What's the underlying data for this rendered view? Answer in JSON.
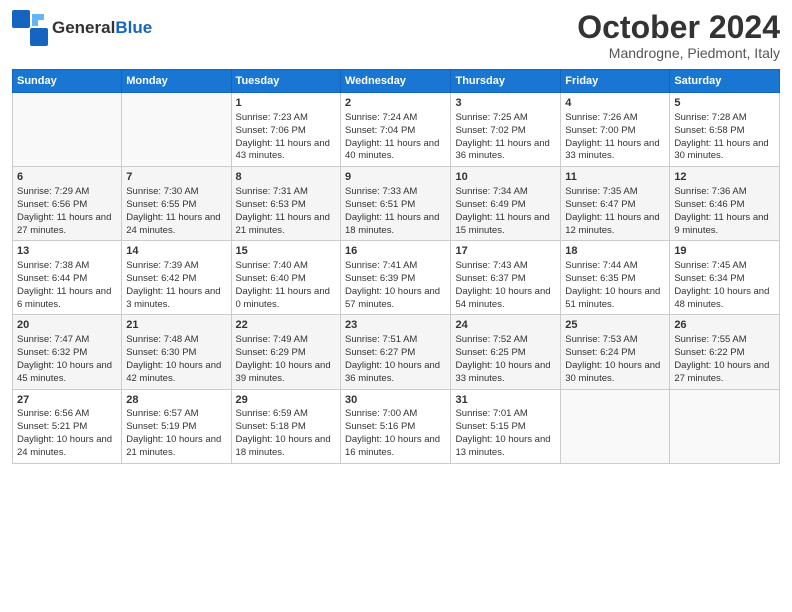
{
  "header": {
    "logo_general": "General",
    "logo_blue": "Blue",
    "month_title": "October 2024",
    "location": "Mandrogne, Piedmont, Italy"
  },
  "days_of_week": [
    "Sunday",
    "Monday",
    "Tuesday",
    "Wednesday",
    "Thursday",
    "Friday",
    "Saturday"
  ],
  "weeks": [
    [
      {
        "day": "",
        "info": ""
      },
      {
        "day": "",
        "info": ""
      },
      {
        "day": "1",
        "info": "Sunrise: 7:23 AM\nSunset: 7:06 PM\nDaylight: 11 hours and 43 minutes."
      },
      {
        "day": "2",
        "info": "Sunrise: 7:24 AM\nSunset: 7:04 PM\nDaylight: 11 hours and 40 minutes."
      },
      {
        "day": "3",
        "info": "Sunrise: 7:25 AM\nSunset: 7:02 PM\nDaylight: 11 hours and 36 minutes."
      },
      {
        "day": "4",
        "info": "Sunrise: 7:26 AM\nSunset: 7:00 PM\nDaylight: 11 hours and 33 minutes."
      },
      {
        "day": "5",
        "info": "Sunrise: 7:28 AM\nSunset: 6:58 PM\nDaylight: 11 hours and 30 minutes."
      }
    ],
    [
      {
        "day": "6",
        "info": "Sunrise: 7:29 AM\nSunset: 6:56 PM\nDaylight: 11 hours and 27 minutes."
      },
      {
        "day": "7",
        "info": "Sunrise: 7:30 AM\nSunset: 6:55 PM\nDaylight: 11 hours and 24 minutes."
      },
      {
        "day": "8",
        "info": "Sunrise: 7:31 AM\nSunset: 6:53 PM\nDaylight: 11 hours and 21 minutes."
      },
      {
        "day": "9",
        "info": "Sunrise: 7:33 AM\nSunset: 6:51 PM\nDaylight: 11 hours and 18 minutes."
      },
      {
        "day": "10",
        "info": "Sunrise: 7:34 AM\nSunset: 6:49 PM\nDaylight: 11 hours and 15 minutes."
      },
      {
        "day": "11",
        "info": "Sunrise: 7:35 AM\nSunset: 6:47 PM\nDaylight: 11 hours and 12 minutes."
      },
      {
        "day": "12",
        "info": "Sunrise: 7:36 AM\nSunset: 6:46 PM\nDaylight: 11 hours and 9 minutes."
      }
    ],
    [
      {
        "day": "13",
        "info": "Sunrise: 7:38 AM\nSunset: 6:44 PM\nDaylight: 11 hours and 6 minutes."
      },
      {
        "day": "14",
        "info": "Sunrise: 7:39 AM\nSunset: 6:42 PM\nDaylight: 11 hours and 3 minutes."
      },
      {
        "day": "15",
        "info": "Sunrise: 7:40 AM\nSunset: 6:40 PM\nDaylight: 11 hours and 0 minutes."
      },
      {
        "day": "16",
        "info": "Sunrise: 7:41 AM\nSunset: 6:39 PM\nDaylight: 10 hours and 57 minutes."
      },
      {
        "day": "17",
        "info": "Sunrise: 7:43 AM\nSunset: 6:37 PM\nDaylight: 10 hours and 54 minutes."
      },
      {
        "day": "18",
        "info": "Sunrise: 7:44 AM\nSunset: 6:35 PM\nDaylight: 10 hours and 51 minutes."
      },
      {
        "day": "19",
        "info": "Sunrise: 7:45 AM\nSunset: 6:34 PM\nDaylight: 10 hours and 48 minutes."
      }
    ],
    [
      {
        "day": "20",
        "info": "Sunrise: 7:47 AM\nSunset: 6:32 PM\nDaylight: 10 hours and 45 minutes."
      },
      {
        "day": "21",
        "info": "Sunrise: 7:48 AM\nSunset: 6:30 PM\nDaylight: 10 hours and 42 minutes."
      },
      {
        "day": "22",
        "info": "Sunrise: 7:49 AM\nSunset: 6:29 PM\nDaylight: 10 hours and 39 minutes."
      },
      {
        "day": "23",
        "info": "Sunrise: 7:51 AM\nSunset: 6:27 PM\nDaylight: 10 hours and 36 minutes."
      },
      {
        "day": "24",
        "info": "Sunrise: 7:52 AM\nSunset: 6:25 PM\nDaylight: 10 hours and 33 minutes."
      },
      {
        "day": "25",
        "info": "Sunrise: 7:53 AM\nSunset: 6:24 PM\nDaylight: 10 hours and 30 minutes."
      },
      {
        "day": "26",
        "info": "Sunrise: 7:55 AM\nSunset: 6:22 PM\nDaylight: 10 hours and 27 minutes."
      }
    ],
    [
      {
        "day": "27",
        "info": "Sunrise: 6:56 AM\nSunset: 5:21 PM\nDaylight: 10 hours and 24 minutes."
      },
      {
        "day": "28",
        "info": "Sunrise: 6:57 AM\nSunset: 5:19 PM\nDaylight: 10 hours and 21 minutes."
      },
      {
        "day": "29",
        "info": "Sunrise: 6:59 AM\nSunset: 5:18 PM\nDaylight: 10 hours and 18 minutes."
      },
      {
        "day": "30",
        "info": "Sunrise: 7:00 AM\nSunset: 5:16 PM\nDaylight: 10 hours and 16 minutes."
      },
      {
        "day": "31",
        "info": "Sunrise: 7:01 AM\nSunset: 5:15 PM\nDaylight: 10 hours and 13 minutes."
      },
      {
        "day": "",
        "info": ""
      },
      {
        "day": "",
        "info": ""
      }
    ]
  ]
}
